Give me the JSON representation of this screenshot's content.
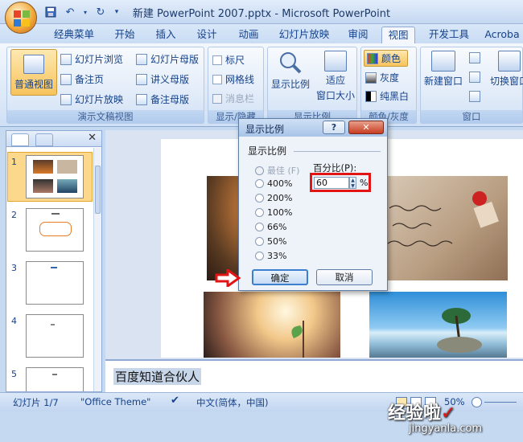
{
  "window": {
    "title": "新建 PowerPoint 2007.pptx - Microsoft PowerPoint"
  },
  "tabs": [
    "经典菜单",
    "开始",
    "插入",
    "设计",
    "动画",
    "幻灯片放映",
    "审阅",
    "视图",
    "开发工具",
    "Acroba"
  ],
  "active_tab": "视图",
  "ribbon": {
    "view_group": {
      "label": "演示文稿视图",
      "normal": "普通视图",
      "sorter": "幻灯片浏览",
      "notes": "备注页",
      "show": "幻灯片放映",
      "slide_master": "幻灯片母版",
      "handout_master": "讲义母版",
      "notes_master": "备注母版"
    },
    "show_group": {
      "label": "显示/隐藏",
      "ruler": "标尺",
      "grid": "网格线",
      "msgbar": "消息栏"
    },
    "zoom_group": {
      "label": "显示比例",
      "zoom": "显示比例",
      "fit": "适应",
      "fit2": "窗口大小"
    },
    "color_group": {
      "label": "颜色/灰度",
      "color": "颜色",
      "gray": "灰度",
      "bw": "纯黑白"
    },
    "window_group": {
      "label": "窗口",
      "new": "新建窗口",
      "switch": "切换窗口"
    }
  },
  "slides": [
    "1",
    "2",
    "3",
    "4",
    "5"
  ],
  "notes_text": "百度知道合伙人",
  "status": {
    "slide": "幻灯片 1/7",
    "theme": "\"Office Theme\"",
    "lang": "中文(简体，中国)",
    "zoom": "50%"
  },
  "dialog": {
    "title": "显示比例",
    "help": "?",
    "close": "✕",
    "section": "显示比例",
    "options": [
      "最佳 (F)",
      "400%",
      "200%",
      "100%",
      "66%",
      "50%",
      "33%"
    ],
    "percent_label": "百分比(P):",
    "percent_value": "60",
    "percent_unit": "%",
    "ok": "确定",
    "cancel": "取消"
  },
  "watermark": {
    "brand": "经验啦",
    "check": "✓",
    "url": "jingyanla.com"
  }
}
